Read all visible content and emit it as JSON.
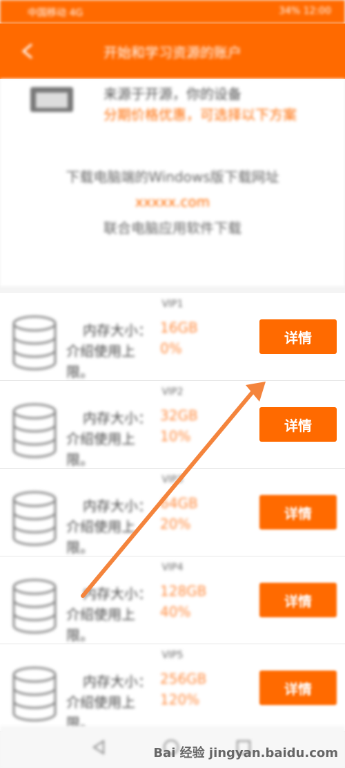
{
  "status": {
    "left_text": "中国移动 4G",
    "right_text": "34% 12:00"
  },
  "header": {
    "title": "开始和学习资源的账户"
  },
  "intro": {
    "line1": "来源于开源，你的设备",
    "line2": "分期价格优惠，可选择以下方案",
    "desc": "下载电脑端的Windows版下载网址",
    "url": "xxxxx.com",
    "desc2": "联合电脑应用软件下载"
  },
  "rows": [
    {
      "title": "VIP1",
      "total_label": "内存大小：",
      "total": "16GB",
      "used_label": "介绍使用上",
      "used": "0%",
      "used_label2": "限。",
      "button": "详情"
    },
    {
      "title": "VIP2",
      "total_label": "内存大小：",
      "total": "32GB",
      "used_label": "介绍使用上",
      "used": "10%",
      "used_label2": "限。",
      "button": "详情"
    },
    {
      "title": "VIP3",
      "total_label": "内存大小：",
      "total": "64GB",
      "used_label": "介绍使用上",
      "used": "20%",
      "used_label2": "限。",
      "button": "详情"
    },
    {
      "title": "VIP4",
      "total_label": "内存大小：",
      "total": "128GB",
      "used_label": "介绍使用上",
      "used": "40%",
      "used_label2": "限。",
      "button": "详情"
    },
    {
      "title": "VIP5",
      "total_label": "内存大小：",
      "total": "256GB",
      "used_label": "介绍使用上",
      "used": "120%",
      "used_label2": "限。",
      "button": "详情"
    }
  ],
  "watermark": "Bai 经验 jingyan.baidu.com",
  "colors": {
    "accent": "#ff6a00",
    "annotation_arrow": "#f4843c"
  },
  "icons": {
    "back": "back-arrow-icon",
    "intro": "document-icon",
    "row": "database-icon",
    "nav_back": "triangle-back-icon",
    "nav_home": "circle-home-icon",
    "nav_recent": "square-recent-icon"
  }
}
